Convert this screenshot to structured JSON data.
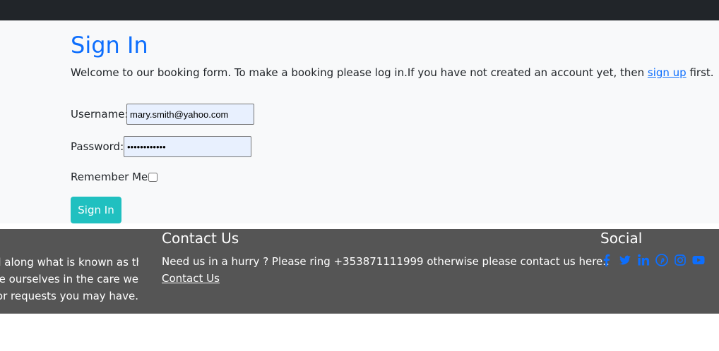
{
  "signin": {
    "title": "Sign In",
    "intro": "Welcome to our booking form. To make a booking please log in.If you have not created an account yet, then ",
    "intro_link": "sign up",
    "intro_end": " first.",
    "username_label": "Username:",
    "username_value": "mary.smith@yahoo.com",
    "password_label": "Password:",
    "password_value": "••••••••••••",
    "remember_label": "Remember Me:",
    "remember_checked": false,
    "button_label": "Sign In"
  },
  "footer": {
    "about_lines": [
      "d along what is known as the",
      "e ourselves in the care we",
      "or requests you may have."
    ],
    "contact_heading": "Contact Us",
    "contact_text": "Need us in a hurry ? Please ring +353871111999 otherwise please contact us here..",
    "contact_link": "Contact Us",
    "social_heading": "Social",
    "social_icons": [
      "facebook-icon",
      "twitter-icon",
      "linkedin-icon",
      "pinterest-icon",
      "instagram-icon",
      "youtube-icon"
    ],
    "icon_color": "#0d6efd"
  },
  "colors": {
    "topbar": "#212529",
    "main_bg": "#f8f9fa",
    "accent": "#0d6efd",
    "button": "#20c0c0",
    "footer_bg": "#555555"
  }
}
